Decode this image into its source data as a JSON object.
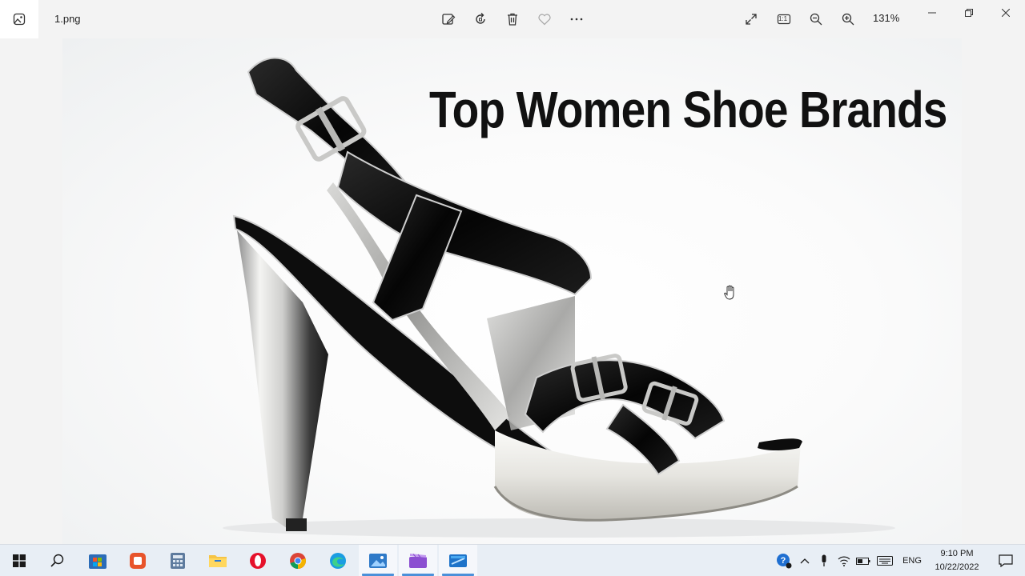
{
  "titlebar": {
    "file_name": "1.png",
    "zoom_level": "131%",
    "icons": [
      "photos-app-icon",
      "edit-image-icon",
      "rotate-icon",
      "delete-icon",
      "favorite-icon",
      "more-icon",
      "fit-expand-icon",
      "actual-size-icon",
      "zoom-out-icon",
      "zoom-in-icon"
    ],
    "actual_size_label": "1:1"
  },
  "image": {
    "headline": "Top Women Shoe Brands"
  },
  "taskbar": {
    "apps": [
      "start-icon",
      "search-icon",
      "store-icon",
      "office-icon",
      "calculator-icon",
      "file-explorer-icon",
      "opera-icon",
      "chrome-icon",
      "edge-icon",
      "photos-icon",
      "video-editor-icon",
      "whiteboard-icon"
    ],
    "language": "ENG",
    "time": "9:10 PM",
    "date": "10/22/2022"
  },
  "colors": {
    "accent": "#4a90d9",
    "headline": "#111111",
    "shoe_leather": "#0d0d0d"
  }
}
